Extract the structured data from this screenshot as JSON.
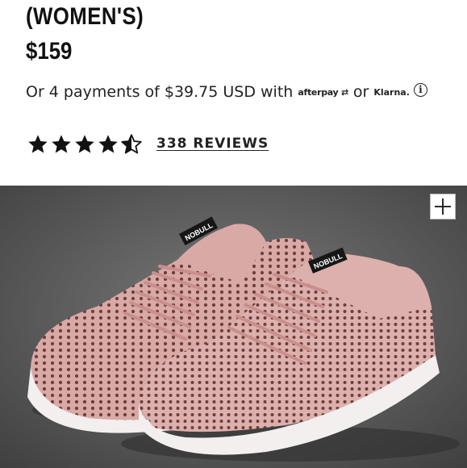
{
  "product": {
    "title": "(WOMEN'S)",
    "price": "$159"
  },
  "payment": {
    "text": "Or 4 payments of $39.75 USD with",
    "afterpay_label": "afterpay",
    "or_label": "or",
    "klarna_label": "Klarna.",
    "info_glyph": "i"
  },
  "rating": {
    "value": 4.5,
    "max": 5,
    "reviews_label": "338 REVIEWS"
  },
  "image": {
    "tongue_label": "NOBULL",
    "zoom_icon": "plus-icon"
  },
  "colors": {
    "text": "#111111",
    "shoe": "#d9a9a6",
    "sole": "#f2efee",
    "background": "#5d5d5d"
  }
}
